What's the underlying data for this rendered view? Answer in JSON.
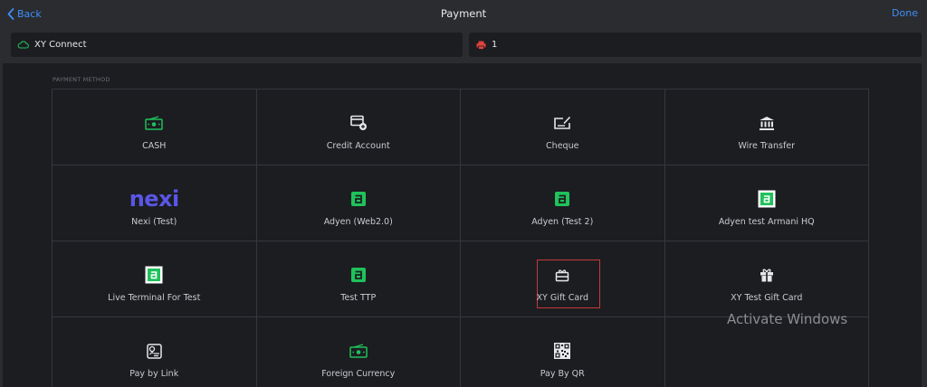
{
  "header": {
    "back_label": "Back",
    "title": "Payment",
    "done_label": "Done"
  },
  "infobar": {
    "connection_label": "XY Connect",
    "printer_label": "1"
  },
  "section_label": "PAYMENT METHOD",
  "methods": [
    {
      "label": "CASH",
      "icon": "cash-icon"
    },
    {
      "label": "Credit Account",
      "icon": "credit-account-icon"
    },
    {
      "label": "Cheque",
      "icon": "cheque-icon"
    },
    {
      "label": "Wire Transfer",
      "icon": "bank-icon"
    },
    {
      "label": "Nexi (Test)",
      "icon": "nexi-logo",
      "logo_text": "nexi"
    },
    {
      "label": "Adyen (Web2.0)",
      "icon": "adyen-icon"
    },
    {
      "label": "Adyen (Test 2)",
      "icon": "adyen-icon"
    },
    {
      "label": "Adyen test Armani HQ",
      "icon": "adyen-boxed-icon"
    },
    {
      "label": "Live Terminal For Test",
      "icon": "adyen-boxed-icon"
    },
    {
      "label": "Test TTP",
      "icon": "adyen-icon"
    },
    {
      "label": "XY Gift Card",
      "icon": "gift-card-icon"
    },
    {
      "label": "XY Test Gift Card",
      "icon": "gift-icon"
    },
    {
      "label": "Pay by Link",
      "icon": "pay-by-link-icon"
    },
    {
      "label": "Foreign Currency",
      "icon": "cash-icon"
    },
    {
      "label": "Pay By QR",
      "icon": "qr-code-icon"
    }
  ],
  "watermark": "Activate Windows",
  "colors": {
    "accent": "#3e8ef7",
    "green": "#1fc25b",
    "nexi": "#5a56e6",
    "highlight": "#c43a3a",
    "printer": "#e0443c"
  }
}
